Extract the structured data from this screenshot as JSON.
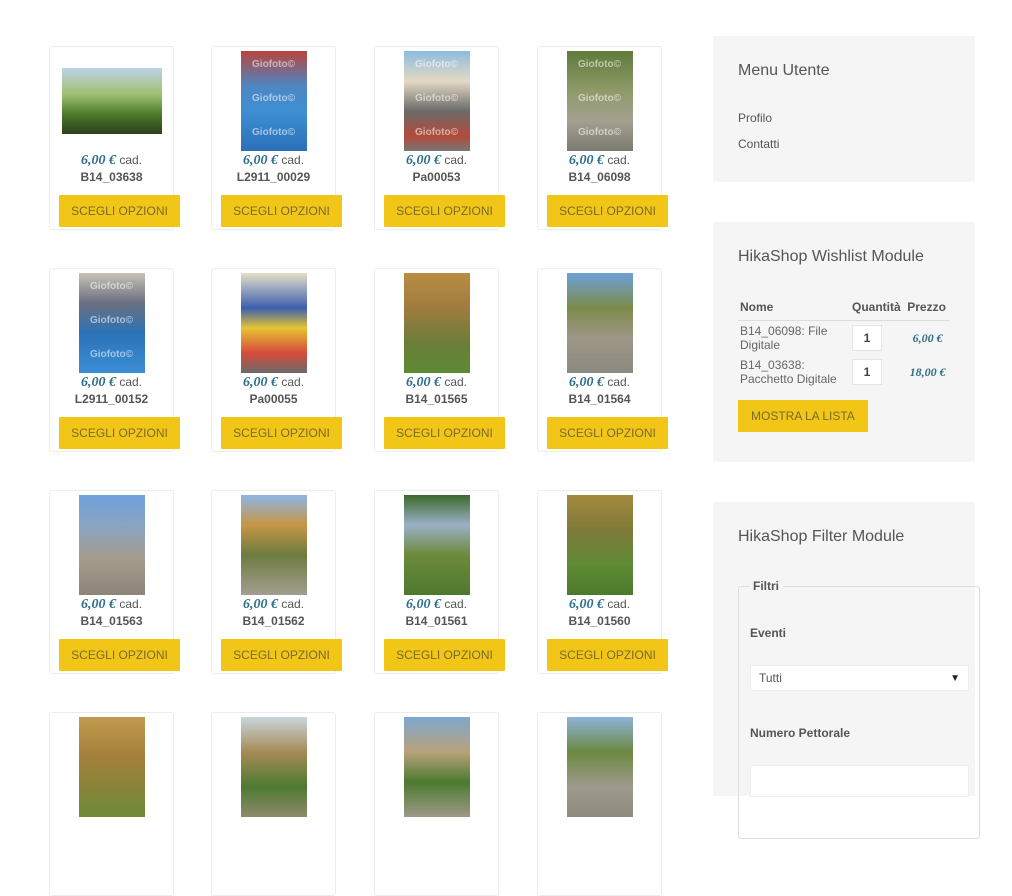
{
  "products": [
    {
      "price": "6,00 €",
      "unit": " cad.",
      "code": "B14_03638",
      "button": "SCEGLI OPZIONI",
      "orientation": "landscape",
      "bg": "linear-gradient(180deg,#bcd3e8 0%,#9fc071 40%,#4d7a2c 70%,#2d3f1d 100%)",
      "watermark": ""
    },
    {
      "price": "6,00 €",
      "unit": " cad.",
      "code": "L2911_00029",
      "button": "SCEGLI OPZIONI",
      "orientation": "portrait",
      "bg": "linear-gradient(180deg,#b6453d 0%,#4f86c2 35%,#3e8fd4 60%,#2b6fb8 100%)",
      "watermark": "Giofoto©"
    },
    {
      "price": "6,00 €",
      "unit": " cad.",
      "code": "Pa00053",
      "button": "SCEGLI OPZIONI",
      "orientation": "portrait",
      "bg": "linear-gradient(180deg,#8dbbe0 0%,#e4d9c4 30%,#6b6b6b 60%,#b44a3a 85%,#777 100%)",
      "watermark": "Giofoto©"
    },
    {
      "price": "6,00 €",
      "unit": " cad.",
      "code": "B14_06098",
      "button": "SCEGLI OPZIONI",
      "orientation": "portrait",
      "bg": "linear-gradient(180deg,#5f7a3a 0%,#8f9a6a 40%,#a4a090 70%,#7b7a70 100%)",
      "watermark": "Giofoto©"
    },
    {
      "price": "6,00 €",
      "unit": " cad.",
      "code": "L2911_00152",
      "button": "SCEGLI OPZIONI",
      "orientation": "portrait",
      "bg": "linear-gradient(180deg,#c8c2b4 0%,#6b6f80 30%,#2c72b7 60%,#3b8fd6 100%)",
      "watermark": "Giofoto©"
    },
    {
      "price": "6,00 €",
      "unit": " cad.",
      "code": "Pa00055",
      "button": "SCEGLI OPZIONI",
      "orientation": "portrait",
      "bg": "linear-gradient(180deg,#e5dfc9 0%,#3d5fae 35%,#e5c433 55%,#d84a3c 80%,#6a6a6a 100%)",
      "watermark": ""
    },
    {
      "price": "6,00 €",
      "unit": " cad.",
      "code": "B14_01565",
      "button": "SCEGLI OPZIONI",
      "orientation": "portrait",
      "bg": "linear-gradient(180deg,#b98d43 0%,#9f7c3e 35%,#6c7d3a 70%,#5c8a33 100%)",
      "watermark": ""
    },
    {
      "price": "6,00 €",
      "unit": " cad.",
      "code": "B14_01564",
      "button": "SCEGLI OPZIONI",
      "orientation": "portrait",
      "bg": "linear-gradient(180deg,#6ea0d8 0%,#7b8b4a 35%,#9e9788 65%,#8a8a80 100%)",
      "watermark": ""
    },
    {
      "price": "6,00 €",
      "unit": " cad.",
      "code": "B14_01563",
      "button": "SCEGLI OPZIONI",
      "orientation": "portrait",
      "bg": "linear-gradient(180deg,#6fa2dc 0%,#89a3c2 30%,#a59b8c 65%,#8c8478 100%)",
      "watermark": ""
    },
    {
      "price": "6,00 €",
      "unit": " cad.",
      "code": "B14_01562",
      "button": "SCEGLI OPZIONI",
      "orientation": "portrait",
      "bg": "linear-gradient(180deg,#8db6e6 0%,#c69545 30%,#6d7c3f 60%,#a29d91 100%)",
      "watermark": ""
    },
    {
      "price": "6,00 €",
      "unit": " cad.",
      "code": "B14_01561",
      "button": "SCEGLI OPZIONI",
      "orientation": "portrait",
      "bg": "linear-gradient(180deg,#3b6a2a 0%,#9bb0c7 30%,#6d8a3c 60%,#4e7a2e 100%)",
      "watermark": ""
    },
    {
      "price": "6,00 €",
      "unit": " cad.",
      "code": "B14_01560",
      "button": "SCEGLI OPZIONI",
      "orientation": "portrait",
      "bg": "linear-gradient(180deg,#a3893e 0%,#7f7a3a 35%,#5e8a34 70%,#4b7a2b 100%)",
      "watermark": ""
    },
    {
      "price": "",
      "unit": "",
      "code": "",
      "button": "",
      "orientation": "portrait",
      "bg": "linear-gradient(180deg,#c09a4e 0%,#a47f3b 40%,#6d8a39 100%)",
      "watermark": ""
    },
    {
      "price": "",
      "unit": "",
      "code": "",
      "button": "",
      "orientation": "portrait",
      "bg": "linear-gradient(180deg,#c9d5dc 0%,#a58b57 35%,#4e7a32 70%,#8d8a6c 100%)",
      "watermark": ""
    },
    {
      "price": "",
      "unit": "",
      "code": "",
      "button": "",
      "orientation": "portrait",
      "bg": "linear-gradient(180deg,#7fa7cf 0%,#b9a27a 35%,#4b7a30 65%,#9f9888 100%)",
      "watermark": ""
    },
    {
      "price": "",
      "unit": "",
      "code": "",
      "button": "",
      "orientation": "portrait",
      "bg": "linear-gradient(180deg,#8fb3d9 0%,#6c8840 35%,#9e9a8c 70%,#8e8a7e 100%)",
      "watermark": ""
    }
  ],
  "menu_utente": {
    "title": "Menu Utente",
    "links": [
      "Profilo",
      "Contatti"
    ]
  },
  "wishlist": {
    "title": "HikaShop Wishlist Module",
    "headers": {
      "name": "Nome",
      "qty": "Quantità",
      "price": "Prezzo"
    },
    "rows": [
      {
        "name": "B14_06098: File Digitale",
        "qty": "1",
        "price": "6,00 €"
      },
      {
        "name": "B14_03638: Pacchetto Digitale",
        "qty": "1",
        "price": "18,00 €"
      }
    ],
    "button": "MOSTRA LA LISTA"
  },
  "filter": {
    "title": "HikaShop Filter Module",
    "legend": "Filtri",
    "eventi_label": "Eventi",
    "eventi_value": "Tutti",
    "pettorale_label": "Numero Pettorale"
  },
  "colors": {
    "accent": "#f1c617",
    "price": "#2f6f8c"
  }
}
